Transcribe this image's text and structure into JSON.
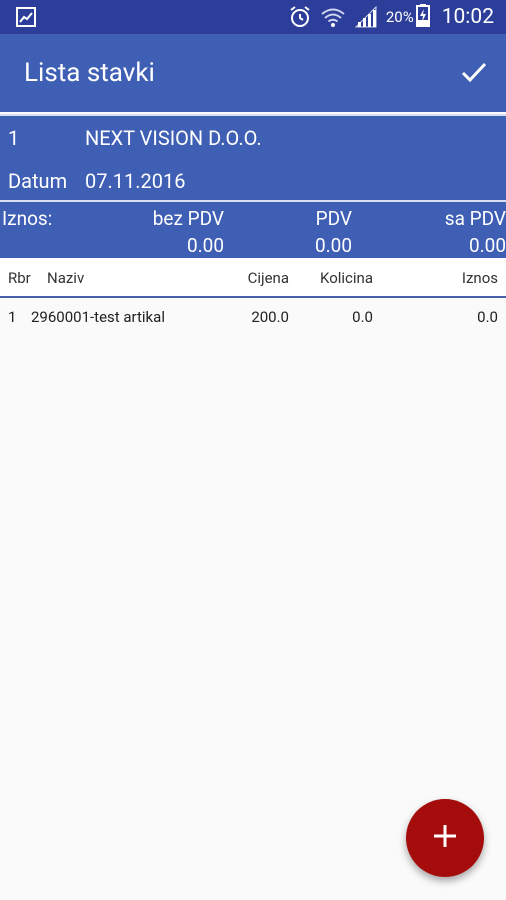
{
  "status_bar": {
    "battery_percent": "20%",
    "time": "10:02",
    "icons": [
      "image-notification-icon",
      "alarm-icon",
      "wifi-icon",
      "signal-icon",
      "battery-charging-icon"
    ]
  },
  "app_bar": {
    "title": "Lista stavki",
    "confirm_icon": "check-icon"
  },
  "document": {
    "number": "1",
    "partner": "NEXT VISION D.O.O.",
    "date_label": "Datum",
    "date_value": "07.11.2016"
  },
  "totals": {
    "label": "Iznos:",
    "headers": [
      "bez PDV",
      "PDV",
      "sa PDV"
    ],
    "values": [
      "0.00",
      "0.00",
      "0.00"
    ]
  },
  "table": {
    "columns": [
      "Rbr",
      "Naziv",
      "Cijena",
      "Kolicina",
      "Iznos"
    ],
    "rows": [
      {
        "rbr": "1",
        "naziv": "2960001-test artikal",
        "cijena": "200.0",
        "kolicina": "0.0",
        "iznos": "0.0"
      }
    ]
  },
  "fab": {
    "icon": "plus-icon"
  },
  "colors": {
    "status_bar": "#2c3e9a",
    "primary": "#3f5fb5",
    "fab": "#a50d0d",
    "background": "#fafafa"
  }
}
